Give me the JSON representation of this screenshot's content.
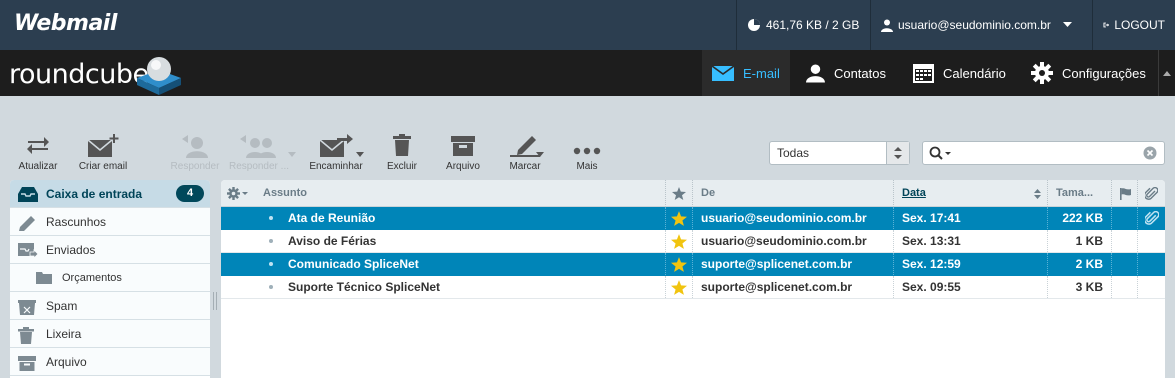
{
  "app": {
    "title": "Webmail",
    "brand": "roundcube"
  },
  "topbar": {
    "quota": "461,76 KB / 2 GB",
    "user": "usuario@seudominio.com.br",
    "logout": "LOGOUT"
  },
  "nav": {
    "email": "E-mail",
    "contacts": "Contatos",
    "calendar": "Calendário",
    "settings": "Configurações"
  },
  "toolbar": {
    "refresh": "Atualizar",
    "compose": "Criar email",
    "reply": "Responder",
    "reply_all": "Responder ...",
    "forward": "Encaminhar",
    "delete": "Excluir",
    "archive": "Arquivo",
    "mark": "Marcar",
    "more": "Mais",
    "filter_value": "Todas"
  },
  "folders": [
    {
      "label": "Caixa de entrada",
      "count": "4",
      "icon": "inbox-icon"
    },
    {
      "label": "Rascunhos",
      "icon": "pencil-icon"
    },
    {
      "label": "Enviados",
      "icon": "sent-icon"
    },
    {
      "label": "Orçamentos",
      "icon": "folder-icon"
    },
    {
      "label": "Spam",
      "icon": "spam-icon"
    },
    {
      "label": "Lixeira",
      "icon": "trash-icon"
    },
    {
      "label": "Arquivo",
      "icon": "archive-icon"
    }
  ],
  "list_headers": {
    "subject": "Assunto",
    "from": "De",
    "date": "Data",
    "size": "Tama..."
  },
  "messages": [
    {
      "subject": "Ata de Reunião",
      "from": "usuario@seudominio.com.br",
      "date": "Sex. 17:41",
      "size": "222 KB",
      "selected": true,
      "flagged": true,
      "attachment": true
    },
    {
      "subject": "Aviso de Férias",
      "from": "usuario@seudominio.com.br",
      "date": "Sex. 13:31",
      "size": "1 KB",
      "selected": false,
      "flagged": true,
      "attachment": false
    },
    {
      "subject": "Comunicado SpliceNet",
      "from": "suporte@splicenet.com.br",
      "date": "Sex. 12:59",
      "size": "2 KB",
      "selected": true,
      "flagged": true,
      "attachment": false
    },
    {
      "subject": "Suporte Técnico SpliceNet",
      "from": "suporte@splicenet.com.br",
      "date": "Sex. 09:55",
      "size": "3 KB",
      "selected": false,
      "flagged": true,
      "attachment": false
    }
  ],
  "colors": {
    "accent": "#37beff",
    "selected_row": "#0085b8",
    "star": "#f1c40f",
    "topbar": "#2c3e50"
  }
}
